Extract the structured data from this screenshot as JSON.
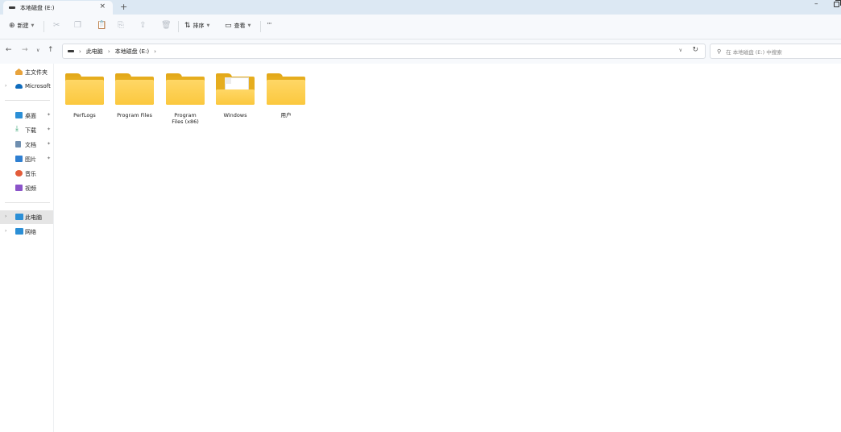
{
  "tab": {
    "title": "本地磁盘 (E:)",
    "close": "×",
    "new_tab": "+"
  },
  "window": {
    "minimize": "–"
  },
  "toolbar": {
    "new_label": "新建",
    "sort_label": "排序",
    "view_label": "查看",
    "more_label": "···"
  },
  "address": {
    "crumbs": [
      "此电脑",
      "本地磁盘 (E:)"
    ]
  },
  "search": {
    "placeholder": "在 本地磁盘 (E:) 中搜索"
  },
  "sidebar": {
    "items": [
      {
        "label": "主文件夹",
        "icon": "home-icon",
        "color": "#e8a33c"
      },
      {
        "label": "Microsoft",
        "icon": "onedrive-icon",
        "color": "#0f6cbd"
      },
      {
        "label": "桌面",
        "icon": "desktop-icon",
        "color": "#2b8fd6",
        "pinned": true
      },
      {
        "label": "下载",
        "icon": "download-icon",
        "color": "#2a9d6a",
        "pinned": true
      },
      {
        "label": "文档",
        "icon": "documents-icon",
        "color": "#6f8fb0",
        "pinned": true
      },
      {
        "label": "图片",
        "icon": "pictures-icon",
        "color": "#2f7fd1",
        "pinned": true
      },
      {
        "label": "音乐",
        "icon": "music-icon",
        "color": "#e35c3a"
      },
      {
        "label": "视频",
        "icon": "videos-icon",
        "color": "#8b54c9"
      },
      {
        "label": "此电脑",
        "icon": "this-pc-icon",
        "color": "#2b8fd6"
      },
      {
        "label": "网络",
        "icon": "network-icon",
        "color": "#2b8fd6"
      }
    ]
  },
  "files": [
    {
      "name": "PerfLogs"
    },
    {
      "name": "Program Files"
    },
    {
      "name": "Program Files (x86)"
    },
    {
      "name": "Windows"
    },
    {
      "name": "用户"
    }
  ]
}
